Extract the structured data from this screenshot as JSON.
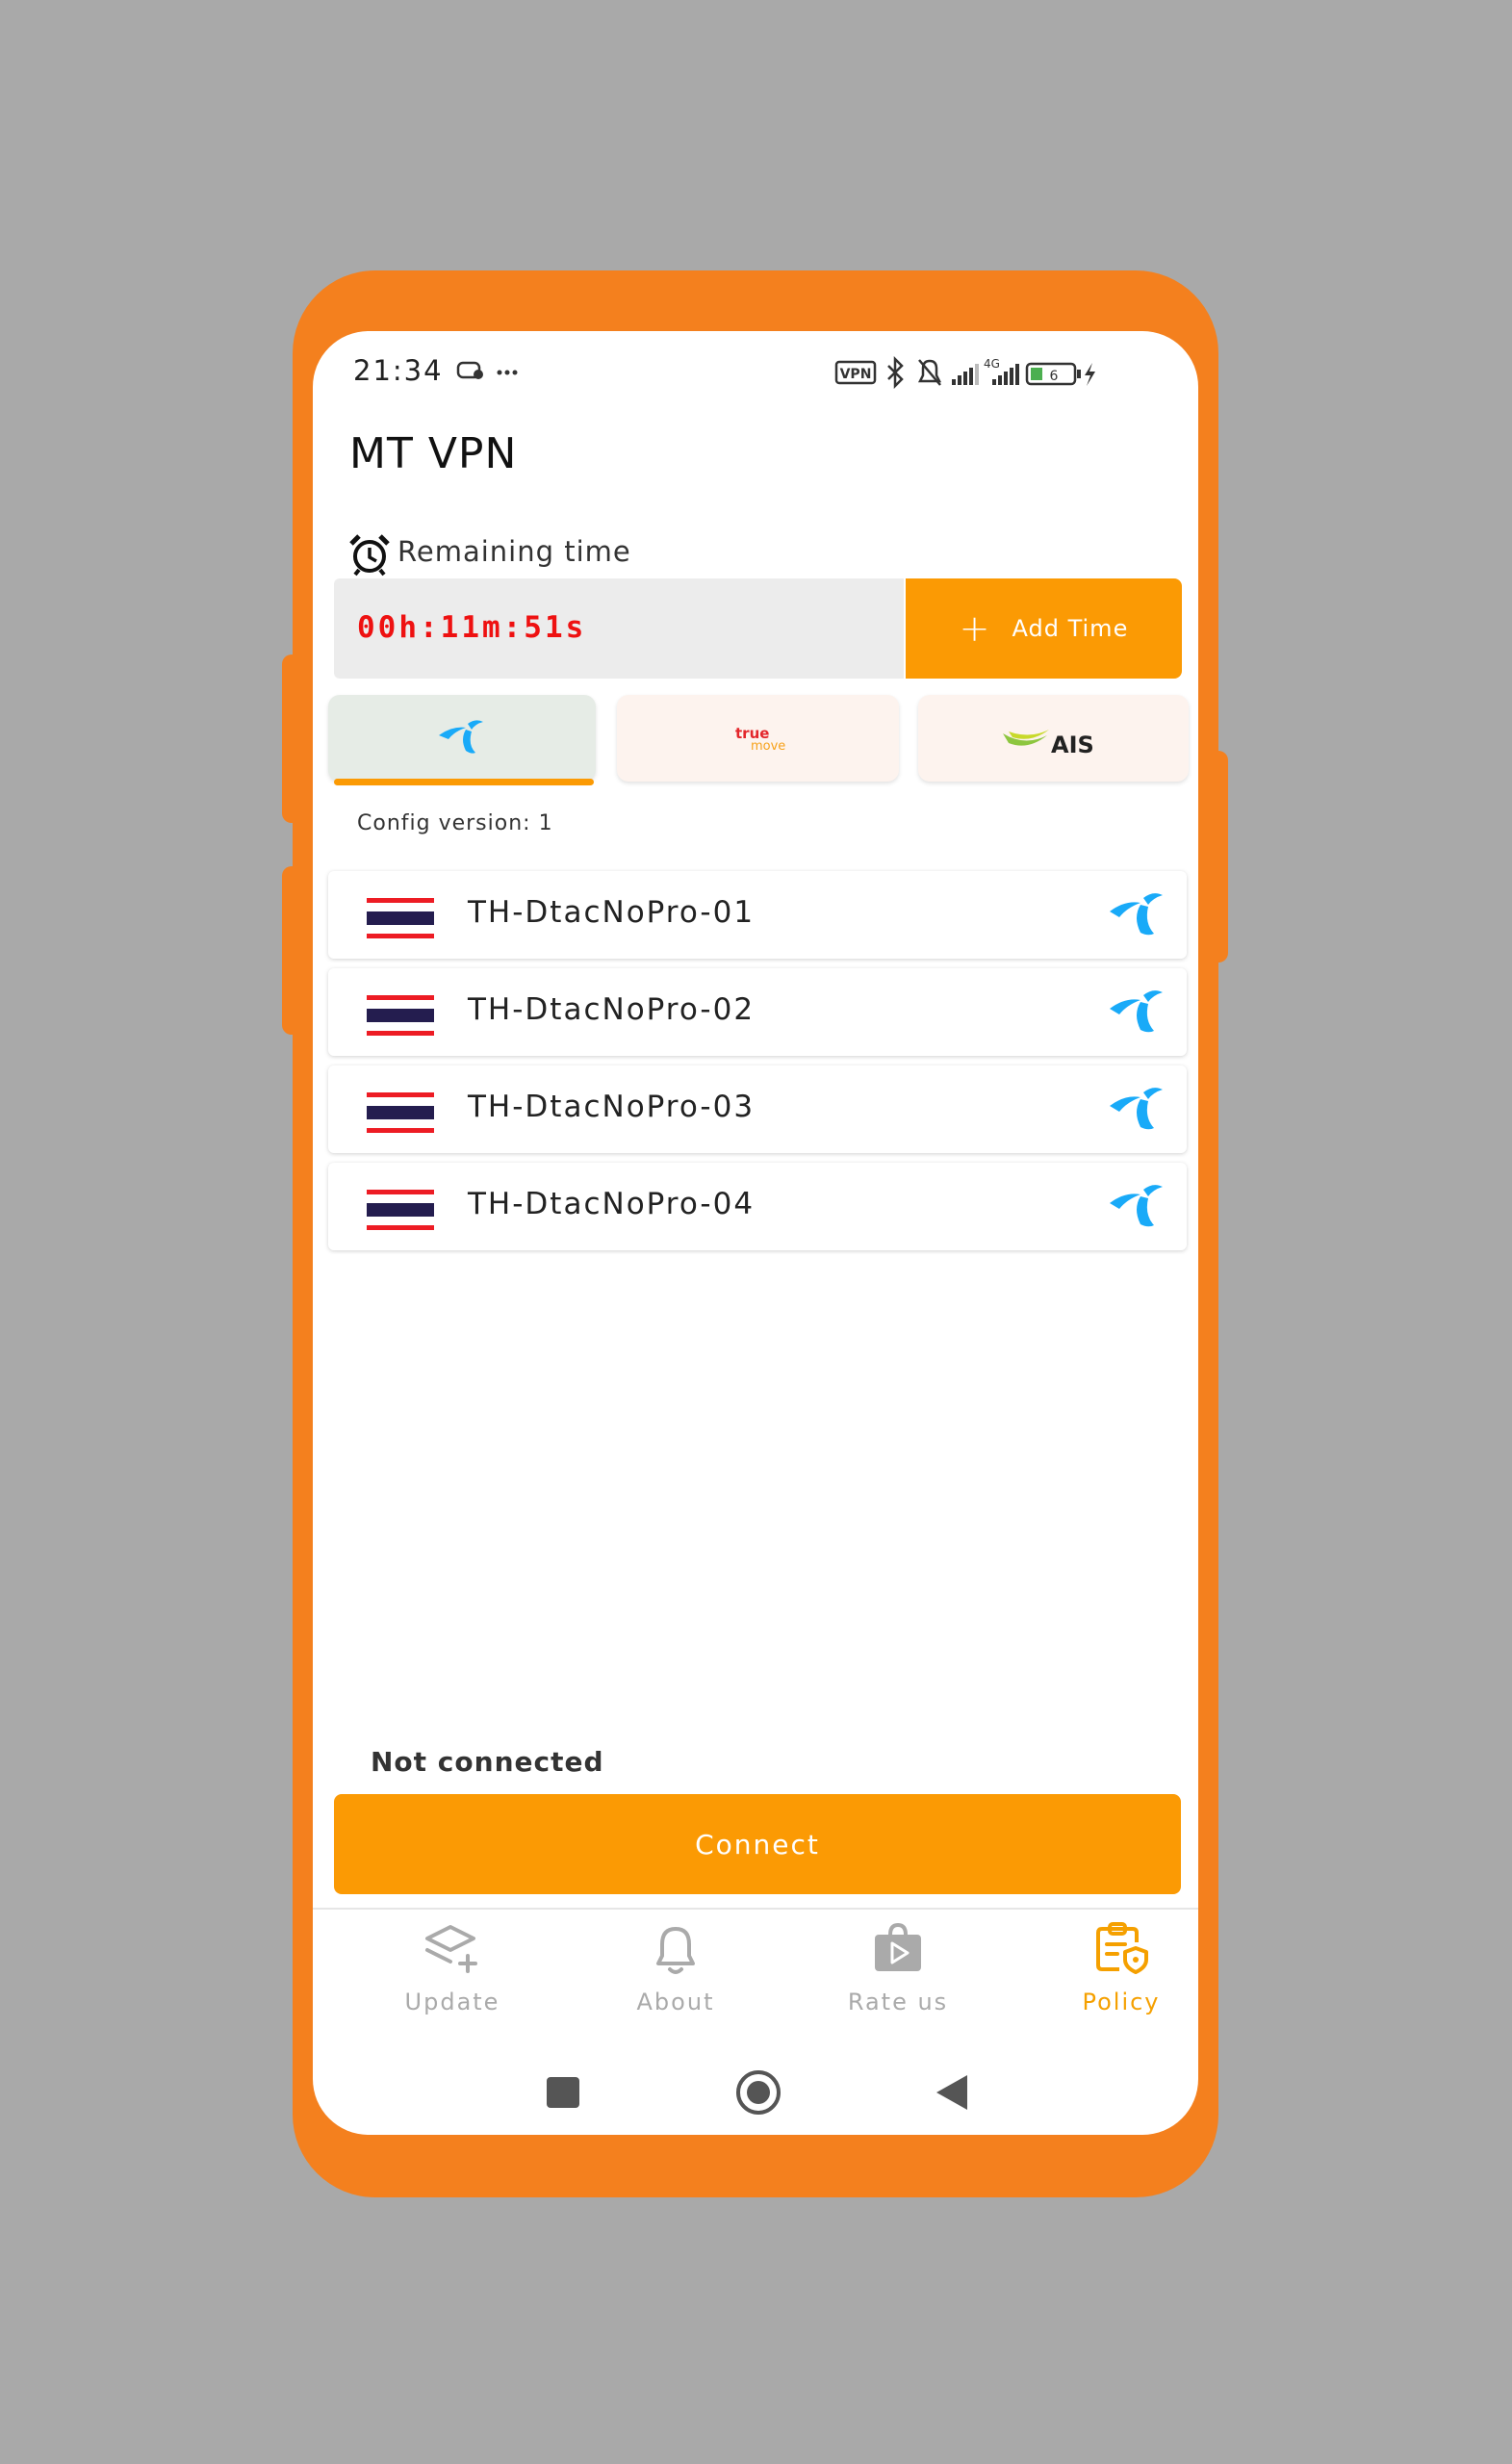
{
  "status_bar": {
    "time": "21:34",
    "vpn_badge": "VPN",
    "network": "4G",
    "battery": "6"
  },
  "app": {
    "title": "MT VPN"
  },
  "timer": {
    "label": "Remaining time",
    "value": "00h:11m:51s",
    "add_label": "Add Time"
  },
  "operators": [
    {
      "name": "dtac",
      "selected": true
    },
    {
      "name": "truemove",
      "logo_top": "true",
      "logo_bottom": "move",
      "selected": false
    },
    {
      "name": "AIS",
      "logo_text": "AIS",
      "selected": false
    }
  ],
  "config": {
    "text": "Config version:  1"
  },
  "servers": [
    {
      "name": "TH-DtacNoPro-01",
      "flag": "thailand",
      "operator_icon": "dtac-icon"
    },
    {
      "name": "TH-DtacNoPro-02",
      "flag": "thailand",
      "operator_icon": "dtac-icon"
    },
    {
      "name": "TH-DtacNoPro-03",
      "flag": "thailand",
      "operator_icon": "dtac-icon"
    },
    {
      "name": "TH-DtacNoPro-04",
      "flag": "thailand",
      "operator_icon": "dtac-icon"
    }
  ],
  "connection": {
    "status": "Not connected",
    "button_label": "Connect"
  },
  "bottom_nav": [
    {
      "label": "Update",
      "icon": "layers-plus-icon",
      "active": false
    },
    {
      "label": "About",
      "icon": "bell-icon",
      "active": false
    },
    {
      "label": "Rate us",
      "icon": "play-store-icon",
      "active": false
    },
    {
      "label": "Policy",
      "icon": "policy-icon",
      "active": true
    }
  ],
  "colors": {
    "accent": "#fb9a04",
    "frame": "#f4801e",
    "timer_text": "#e11111",
    "dtac_blue": "#19aaf8",
    "ais_green": "#8dc63f",
    "true_red": "#e3262b"
  }
}
